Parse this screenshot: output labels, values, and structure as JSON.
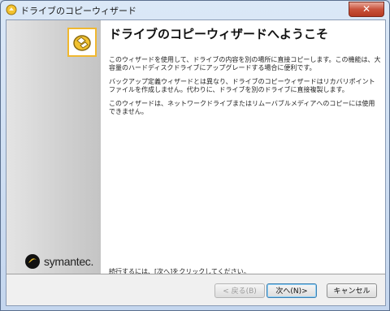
{
  "window": {
    "title": "ドライブのコピーウィザード",
    "close_label": "✕"
  },
  "sidebar": {
    "brand": "symantec."
  },
  "main": {
    "heading": "ドライブのコピーウィザードへようこそ",
    "paragraphs": [
      "このウィザードを使用して、ドライブの内容を別の場所に直接コピーします。この機能は、大容量のハードディスクドライブにアップグレードする場合に便利です。",
      "バックアップ定義ウィザードとは異なり、ドライブのコピーウィザードはリカバリポイントファイルを作成しません。代わりに、ドライブを別のドライブに直接複製します。",
      "このウィザードは、ネットワークドライブまたはリムーバブルメディアへのコピーには使用できません。"
    ],
    "footer": "続行するには、[次へ]をクリックしてください。"
  },
  "buttons": {
    "back": "< 戻る(B)",
    "next": "次へ(N)>",
    "cancel": "キャンセル"
  },
  "colors": {
    "brand_yellow": "#f0b830",
    "titlebar": "#c4d6ee",
    "close_red": "#c8523b"
  }
}
